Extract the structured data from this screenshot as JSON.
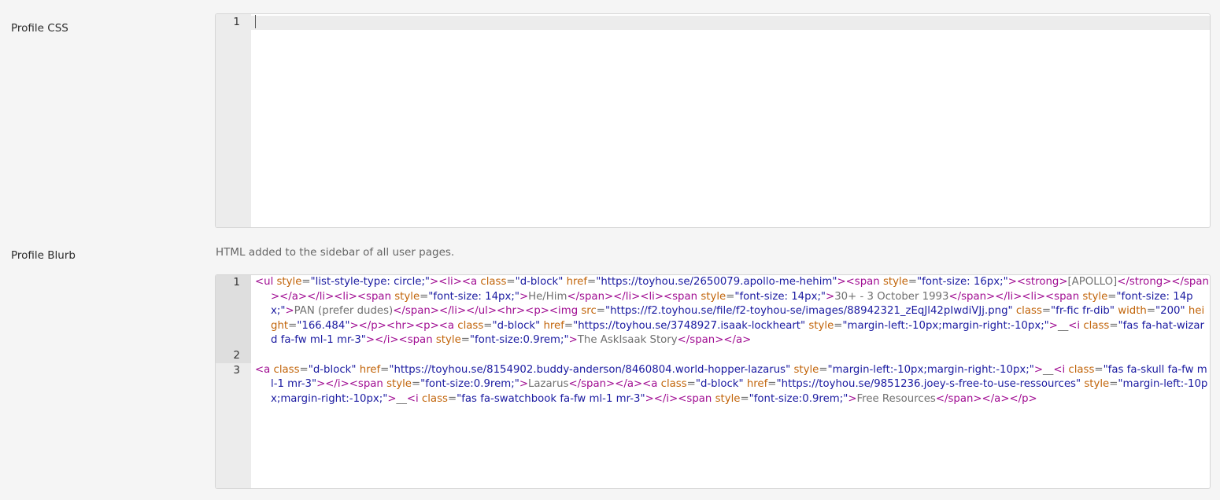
{
  "css_field": {
    "label": "Profile CSS",
    "line_numbers": [
      "1"
    ]
  },
  "blurb_field": {
    "label": "Profile Blurb",
    "help": "HTML added to the sidebar of all user pages.",
    "line_numbers": [
      "1",
      "2",
      "3"
    ],
    "lines": [
      [
        [
          "t",
          "<ul"
        ],
        [
          "x",
          " "
        ],
        [
          "a",
          "style"
        ],
        [
          "x",
          "="
        ],
        [
          "s",
          "\"list-style-type: circle;\""
        ],
        [
          "t",
          ">"
        ],
        [
          "t",
          "<li>"
        ],
        [
          "t",
          "<a"
        ],
        [
          "x",
          " "
        ],
        [
          "a",
          "class"
        ],
        [
          "x",
          "="
        ],
        [
          "s",
          "\"d-block\""
        ],
        [
          "x",
          " "
        ],
        [
          "a",
          "href"
        ],
        [
          "x",
          "="
        ],
        [
          "s",
          "\"https://toyhou.se/2650079.apollo-me-hehim\""
        ],
        [
          "t",
          ">"
        ],
        [
          "t",
          "<span"
        ],
        [
          "x",
          " "
        ],
        [
          "a",
          "style"
        ],
        [
          "x",
          "="
        ],
        [
          "s",
          "\"font-size: 16px;\""
        ],
        [
          "t",
          ">"
        ],
        [
          "t",
          "<strong"
        ],
        [
          "t",
          ">"
        ],
        [
          "x",
          "[APOLLO]"
        ],
        [
          "t",
          "</strong>"
        ],
        [
          "t",
          "</span>"
        ],
        [
          "t",
          "</a>"
        ],
        [
          "t",
          "</li>"
        ],
        [
          "t",
          "<li>"
        ],
        [
          "t",
          "<span"
        ],
        [
          "x",
          " "
        ],
        [
          "a",
          "style"
        ],
        [
          "x",
          "="
        ],
        [
          "s",
          "\"font-size: 14px;\""
        ],
        [
          "t",
          ">"
        ],
        [
          "x",
          "He/Him"
        ],
        [
          "t",
          "</span>"
        ],
        [
          "t",
          "</li>"
        ],
        [
          "t",
          "<li>"
        ],
        [
          "t",
          "<span"
        ],
        [
          "x",
          " "
        ],
        [
          "a",
          "style"
        ],
        [
          "x",
          "="
        ],
        [
          "s",
          "\"font-size: 14px;\""
        ],
        [
          "t",
          ">"
        ],
        [
          "x",
          "30+ - 3 October 1993"
        ],
        [
          "t",
          "</span>"
        ],
        [
          "t",
          "</li>"
        ],
        [
          "t",
          "<li>"
        ],
        [
          "t",
          "<span"
        ],
        [
          "x",
          " "
        ],
        [
          "a",
          "style"
        ],
        [
          "x",
          "="
        ],
        [
          "s",
          "\"font-size: 14px;\""
        ],
        [
          "t",
          ">"
        ],
        [
          "x",
          "PAN (prefer dudes)"
        ],
        [
          "t",
          "</span>"
        ],
        [
          "t",
          "</li>"
        ],
        [
          "t",
          "</ul>"
        ],
        [
          "t",
          "<hr>"
        ],
        [
          "t",
          "<p>"
        ],
        [
          "t",
          "<img"
        ],
        [
          "x",
          " "
        ],
        [
          "a",
          "src"
        ],
        [
          "x",
          "="
        ],
        [
          "s",
          "\"https://f2.toyhou.se/file/f2-toyhou-se/images/88942321_zEqJl42pIwdiVJj.png\""
        ],
        [
          "x",
          " "
        ],
        [
          "a",
          "class"
        ],
        [
          "x",
          "="
        ],
        [
          "s",
          "\"fr-fic fr-dib\""
        ],
        [
          "x",
          " "
        ],
        [
          "a",
          "width"
        ],
        [
          "x",
          "="
        ],
        [
          "s",
          "\"200\""
        ],
        [
          "x",
          " "
        ],
        [
          "a",
          "height"
        ],
        [
          "x",
          "="
        ],
        [
          "s",
          "\"166.484\""
        ],
        [
          "t",
          ">"
        ],
        [
          "t",
          "</p>"
        ],
        [
          "t",
          "<hr>"
        ],
        [
          "t",
          "<p>"
        ],
        [
          "t",
          "<a"
        ],
        [
          "x",
          " "
        ],
        [
          "a",
          "class"
        ],
        [
          "x",
          "="
        ],
        [
          "s",
          "\"d-block\""
        ],
        [
          "x",
          " "
        ],
        [
          "a",
          "href"
        ],
        [
          "x",
          "="
        ],
        [
          "s",
          "\"https://toyhou.se/3748927.isaak-lockheart\""
        ],
        [
          "x",
          " "
        ],
        [
          "a",
          "style"
        ],
        [
          "x",
          "="
        ],
        [
          "s",
          "\"margin-left:-10px;margin-right:-10px;\""
        ],
        [
          "t",
          ">"
        ],
        [
          "x",
          "__"
        ],
        [
          "t",
          "<i"
        ],
        [
          "x",
          " "
        ],
        [
          "a",
          "class"
        ],
        [
          "x",
          "="
        ],
        [
          "s",
          "\"fas fa-hat-wizard fa-fw ml-1 mr-3\""
        ],
        [
          "t",
          ">"
        ],
        [
          "t",
          "</i>"
        ],
        [
          "t",
          "<span"
        ],
        [
          "x",
          " "
        ],
        [
          "a",
          "style"
        ],
        [
          "x",
          "="
        ],
        [
          "s",
          "\"font-size:0.9rem;\""
        ],
        [
          "t",
          ">"
        ],
        [
          "x",
          "The AskIsaak Story"
        ],
        [
          "t",
          "</span>"
        ],
        [
          "t",
          "</a>"
        ]
      ],
      [],
      [
        [
          "t",
          "<a"
        ],
        [
          "x",
          " "
        ],
        [
          "a",
          "class"
        ],
        [
          "x",
          "="
        ],
        [
          "s",
          "\"d-block\""
        ],
        [
          "x",
          " "
        ],
        [
          "a",
          "href"
        ],
        [
          "x",
          "="
        ],
        [
          "s",
          "\"https://toyhou.se/8154902.buddy-anderson/8460804.world-hopper-lazarus\""
        ],
        [
          "x",
          " "
        ],
        [
          "a",
          "style"
        ],
        [
          "x",
          "="
        ],
        [
          "s",
          "\"margin-left:-10px;margin-right:-10px;\""
        ],
        [
          "t",
          ">"
        ],
        [
          "x",
          "__"
        ],
        [
          "t",
          "<i"
        ],
        [
          "x",
          " "
        ],
        [
          "a",
          "class"
        ],
        [
          "x",
          "="
        ],
        [
          "s",
          "\"fas fa-skull fa-fw ml-1 mr-3\""
        ],
        [
          "t",
          ">"
        ],
        [
          "t",
          "</i>"
        ],
        [
          "t",
          "<span"
        ],
        [
          "x",
          " "
        ],
        [
          "a",
          "style"
        ],
        [
          "x",
          "="
        ],
        [
          "s",
          "\"font-size:0.9rem;\""
        ],
        [
          "t",
          ">"
        ],
        [
          "x",
          "Lazarus"
        ],
        [
          "t",
          "</span>"
        ],
        [
          "t",
          "</a>"
        ],
        [
          "t",
          "<a"
        ],
        [
          "x",
          " "
        ],
        [
          "a",
          "class"
        ],
        [
          "x",
          "="
        ],
        [
          "s",
          "\"d-block\""
        ],
        [
          "x",
          " "
        ],
        [
          "a",
          "href"
        ],
        [
          "x",
          "="
        ],
        [
          "s",
          "\"https://toyhou.se/9851236.joey-s-free-to-use-ressources\""
        ],
        [
          "x",
          " "
        ],
        [
          "a",
          "style"
        ],
        [
          "x",
          "="
        ],
        [
          "s",
          "\"margin-left:-10px;margin-right:-10px;\""
        ],
        [
          "t",
          ">"
        ],
        [
          "x",
          "__"
        ],
        [
          "t",
          "<i"
        ],
        [
          "x",
          " "
        ],
        [
          "a",
          "class"
        ],
        [
          "x",
          "="
        ],
        [
          "s",
          "\"fas fa-swatchbook fa-fw ml-1 mr-3\""
        ],
        [
          "t",
          ">"
        ],
        [
          "t",
          "</i>"
        ],
        [
          "t",
          "<span"
        ],
        [
          "x",
          " "
        ],
        [
          "a",
          "style"
        ],
        [
          "x",
          "="
        ],
        [
          "s",
          "\"font-size:0.9rem;\""
        ],
        [
          "t",
          ">"
        ],
        [
          "x",
          "Free Resources"
        ],
        [
          "t",
          "</span>"
        ],
        [
          "t",
          "</a>"
        ],
        [
          "t",
          "</p>"
        ]
      ]
    ]
  },
  "colors": {
    "tag": "#a00d92",
    "attribute": "#c2650b",
    "string": "#1b1ba1",
    "text": "#707070",
    "gutter": "#ececec"
  }
}
